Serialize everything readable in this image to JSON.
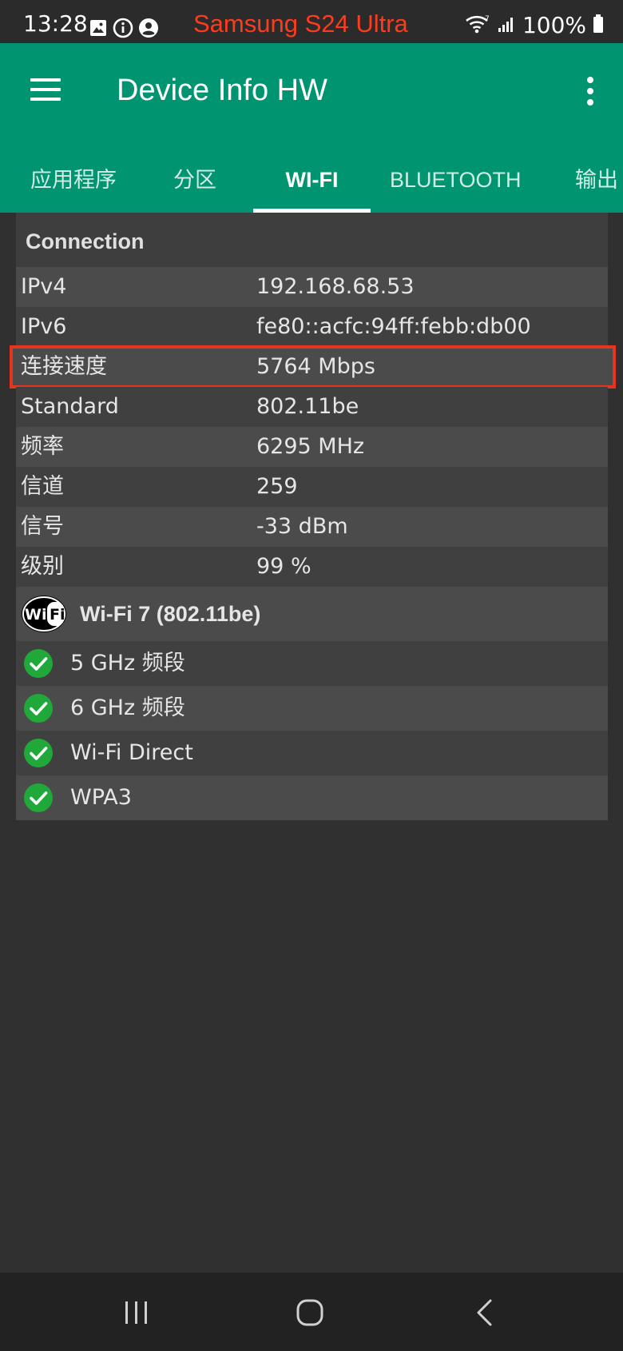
{
  "status_bar": {
    "time": "13:28",
    "device_label": "Samsung S24 Ultra",
    "battery": "100%",
    "icons": [
      "gallery-icon",
      "info-icon",
      "account-icon",
      "wifi-icon",
      "signal-icon",
      "battery-icon"
    ]
  },
  "app_bar": {
    "title": "Device Info HW",
    "tabs": [
      {
        "label": "应用程序"
      },
      {
        "label": "分区"
      },
      {
        "label": "WI-FI"
      },
      {
        "label": "BLUETOOTH"
      },
      {
        "label": "输出"
      }
    ],
    "active_tab": "WI-FI"
  },
  "connection": {
    "title": "Connection",
    "rows": [
      {
        "label": "IPv4",
        "value": "192.168.68.53"
      },
      {
        "label": "IPv6",
        "value": "fe80::acfc:94ff:febb:db00"
      },
      {
        "label": "连接速度",
        "value": "5764 Mbps"
      },
      {
        "label": "Standard",
        "value": "802.11be"
      },
      {
        "label": "频率",
        "value": "6295 MHz"
      },
      {
        "label": "信道",
        "value": "259"
      },
      {
        "label": "信号",
        "value": "-33 dBm"
      },
      {
        "label": "级别",
        "value": "99 %"
      }
    ]
  },
  "wifi7": {
    "badge_text": "WiFi",
    "title": "Wi-Fi 7 (802.11be)",
    "features": [
      {
        "label": "5 GHz 频段"
      },
      {
        "label": "6 GHz 频段"
      },
      {
        "label": "Wi-Fi Direct"
      },
      {
        "label": "WPA3"
      }
    ]
  },
  "colors": {
    "app_bar": "#009471",
    "background": "#303030",
    "highlight": "#e8341c",
    "check": "#21a83b",
    "device_label": "#ff3b1d"
  }
}
